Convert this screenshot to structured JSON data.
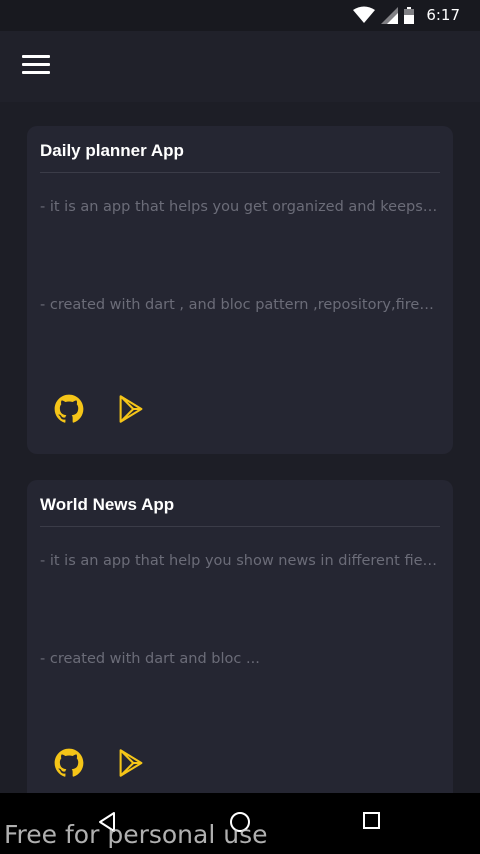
{
  "status_bar": {
    "time": "6:17"
  },
  "colors": {
    "accent": "#f5c518",
    "card": "#252632",
    "background": "#1d1e26"
  },
  "projects": [
    {
      "title": "Daily planner App",
      "description_1": "- it is an app that helps you get organized and keeps all your tasks",
      "description_2": "- created with dart , and bloc pattern ,repository,firebase and more",
      "icons": [
        "github-icon",
        "google-play-icon"
      ]
    },
    {
      "title": "World News App",
      "description_1": "- it is an app that help you show news in different fields and countries",
      "description_2": "- created with dart and bloc ...",
      "icons": [
        "github-icon",
        "google-play-icon"
      ]
    }
  ],
  "watermark": "Free for personal use"
}
